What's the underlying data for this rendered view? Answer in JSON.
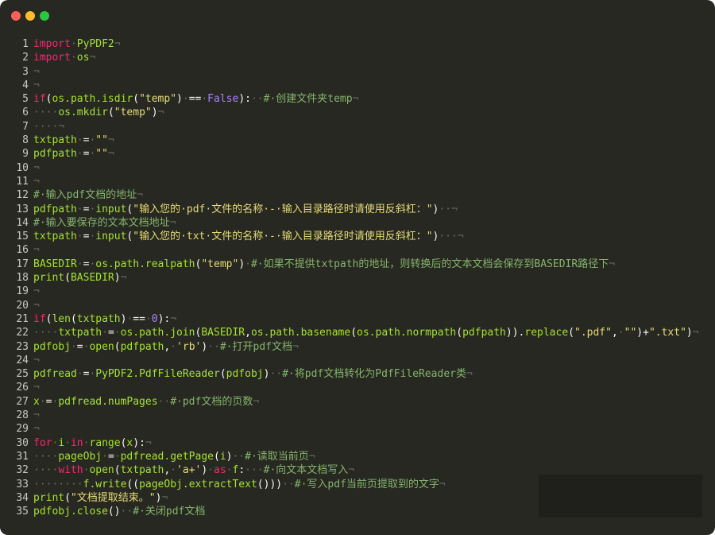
{
  "window": {
    "traffic_lights": [
      "close",
      "minimize",
      "maximize"
    ],
    "colors": {
      "background": "#272822",
      "close": "#ff5f57",
      "minimize": "#febc2e",
      "maximize": "#28c840"
    }
  },
  "code": {
    "lines": [
      {
        "n": "1",
        "tokens": [
          {
            "t": "kw",
            "v": "import"
          },
          {
            "t": "ws",
            "v": "·"
          },
          {
            "t": "id",
            "v": "PyPDF2"
          },
          {
            "t": "nl",
            "v": "¬"
          }
        ]
      },
      {
        "n": "2",
        "tokens": [
          {
            "t": "kw",
            "v": "import"
          },
          {
            "t": "ws",
            "v": "·"
          },
          {
            "t": "id",
            "v": "os"
          },
          {
            "t": "nl",
            "v": "¬"
          }
        ]
      },
      {
        "n": "3",
        "tokens": [
          {
            "t": "nl",
            "v": "¬"
          }
        ]
      },
      {
        "n": "4",
        "tokens": [
          {
            "t": "nl",
            "v": "¬"
          }
        ]
      },
      {
        "n": "5",
        "tokens": [
          {
            "t": "kw",
            "v": "if"
          },
          {
            "t": "op",
            "v": "("
          },
          {
            "t": "id",
            "v": "os.path.isdir"
          },
          {
            "t": "op",
            "v": "("
          },
          {
            "t": "str",
            "v": "\"temp\""
          },
          {
            "t": "op",
            "v": ")"
          },
          {
            "t": "ws",
            "v": "·"
          },
          {
            "t": "op",
            "v": "=="
          },
          {
            "t": "ws",
            "v": "·"
          },
          {
            "t": "const",
            "v": "False"
          },
          {
            "t": "op",
            "v": "):"
          },
          {
            "t": "ws",
            "v": "··"
          },
          {
            "t": "com",
            "v": "#·创建文件夹temp"
          },
          {
            "t": "nl",
            "v": "¬"
          }
        ]
      },
      {
        "n": "6",
        "tokens": [
          {
            "t": "ws",
            "v": "····"
          },
          {
            "t": "id",
            "v": "os.mkdir"
          },
          {
            "t": "op",
            "v": "("
          },
          {
            "t": "str",
            "v": "\"temp\""
          },
          {
            "t": "op",
            "v": ")"
          },
          {
            "t": "nl",
            "v": "¬"
          }
        ]
      },
      {
        "n": "7",
        "tokens": [
          {
            "t": "ws",
            "v": "····"
          },
          {
            "t": "nl",
            "v": "¬"
          }
        ]
      },
      {
        "n": "8",
        "tokens": [
          {
            "t": "id",
            "v": "txtpath"
          },
          {
            "t": "ws",
            "v": "·"
          },
          {
            "t": "op",
            "v": "="
          },
          {
            "t": "ws",
            "v": "·"
          },
          {
            "t": "str",
            "v": "\"\""
          },
          {
            "t": "nl",
            "v": "¬"
          }
        ]
      },
      {
        "n": "9",
        "tokens": [
          {
            "t": "id",
            "v": "pdfpath"
          },
          {
            "t": "ws",
            "v": "·"
          },
          {
            "t": "op",
            "v": "="
          },
          {
            "t": "ws",
            "v": "·"
          },
          {
            "t": "str",
            "v": "\"\""
          },
          {
            "t": "nl",
            "v": "¬"
          }
        ]
      },
      {
        "n": "10",
        "tokens": [
          {
            "t": "nl",
            "v": "¬"
          }
        ]
      },
      {
        "n": "11",
        "tokens": [
          {
            "t": "nl",
            "v": "¬"
          }
        ]
      },
      {
        "n": "12",
        "tokens": [
          {
            "t": "com",
            "v": "#·输入pdf文档的地址"
          },
          {
            "t": "nl",
            "v": "¬"
          }
        ]
      },
      {
        "n": "13",
        "tokens": [
          {
            "t": "id",
            "v": "pdfpath"
          },
          {
            "t": "ws",
            "v": "·"
          },
          {
            "t": "op",
            "v": "="
          },
          {
            "t": "ws",
            "v": "·"
          },
          {
            "t": "fn",
            "v": "input"
          },
          {
            "t": "op",
            "v": "("
          },
          {
            "t": "str",
            "v": "\"输入您的·pdf·文件的名称·-·输入目录路径时请使用反斜杠：\""
          },
          {
            "t": "op",
            "v": ")"
          },
          {
            "t": "ws",
            "v": "··"
          },
          {
            "t": "nl",
            "v": "¬"
          }
        ]
      },
      {
        "n": "14",
        "tokens": [
          {
            "t": "com",
            "v": "#·输入要保存的文本文档地址"
          },
          {
            "t": "nl",
            "v": "¬"
          }
        ]
      },
      {
        "n": "15",
        "tokens": [
          {
            "t": "id",
            "v": "txtpath"
          },
          {
            "t": "ws",
            "v": "·"
          },
          {
            "t": "op",
            "v": "="
          },
          {
            "t": "ws",
            "v": "·"
          },
          {
            "t": "fn",
            "v": "input"
          },
          {
            "t": "op",
            "v": "("
          },
          {
            "t": "str",
            "v": "\"输入您的·txt·文件的名称·-·输入目录路径时请使用反斜杠：\""
          },
          {
            "t": "op",
            "v": ")"
          },
          {
            "t": "ws",
            "v": "···"
          },
          {
            "t": "nl",
            "v": "¬"
          }
        ]
      },
      {
        "n": "16",
        "tokens": [
          {
            "t": "nl",
            "v": "¬"
          }
        ]
      },
      {
        "n": "17",
        "tokens": [
          {
            "t": "id",
            "v": "BASEDIR"
          },
          {
            "t": "ws",
            "v": "·"
          },
          {
            "t": "op",
            "v": "="
          },
          {
            "t": "ws",
            "v": "·"
          },
          {
            "t": "id",
            "v": "os.path.realpath"
          },
          {
            "t": "op",
            "v": "("
          },
          {
            "t": "str",
            "v": "\"temp\""
          },
          {
            "t": "op",
            "v": ")"
          },
          {
            "t": "ws",
            "v": "·"
          },
          {
            "t": "com",
            "v": "#·如果不提供txtpath的地址，则转换后的文本文档会保存到BASEDIR路径下"
          },
          {
            "t": "nl",
            "v": "¬"
          }
        ]
      },
      {
        "n": "18",
        "tokens": [
          {
            "t": "fn",
            "v": "print"
          },
          {
            "t": "op",
            "v": "("
          },
          {
            "t": "id",
            "v": "BASEDIR"
          },
          {
            "t": "op",
            "v": ")"
          },
          {
            "t": "nl",
            "v": "¬"
          }
        ]
      },
      {
        "n": "19",
        "tokens": [
          {
            "t": "nl",
            "v": "¬"
          }
        ]
      },
      {
        "n": "20",
        "tokens": [
          {
            "t": "nl",
            "v": "¬"
          }
        ]
      },
      {
        "n": "21",
        "tokens": [
          {
            "t": "kw",
            "v": "if"
          },
          {
            "t": "op",
            "v": "("
          },
          {
            "t": "fn",
            "v": "len"
          },
          {
            "t": "op",
            "v": "("
          },
          {
            "t": "id",
            "v": "txtpath"
          },
          {
            "t": "op",
            "v": ")"
          },
          {
            "t": "ws",
            "v": "·"
          },
          {
            "t": "op",
            "v": "=="
          },
          {
            "t": "ws",
            "v": "·"
          },
          {
            "t": "num",
            "v": "0"
          },
          {
            "t": "op",
            "v": "):"
          },
          {
            "t": "nl",
            "v": "¬"
          }
        ]
      },
      {
        "n": "22",
        "tokens": [
          {
            "t": "ws",
            "v": "····"
          },
          {
            "t": "id",
            "v": "txtpath"
          },
          {
            "t": "ws",
            "v": "·"
          },
          {
            "t": "op",
            "v": "="
          },
          {
            "t": "ws",
            "v": "·"
          },
          {
            "t": "id",
            "v": "os.path.join"
          },
          {
            "t": "op",
            "v": "("
          },
          {
            "t": "id",
            "v": "BASEDIR"
          },
          {
            "t": "op",
            "v": ","
          },
          {
            "t": "id",
            "v": "os.path.basename"
          },
          {
            "t": "op",
            "v": "("
          },
          {
            "t": "id",
            "v": "os.path.normpath"
          },
          {
            "t": "op",
            "v": "("
          },
          {
            "t": "id",
            "v": "pdfpath"
          },
          {
            "t": "op",
            "v": "))."
          },
          {
            "t": "id",
            "v": "replace"
          },
          {
            "t": "op",
            "v": "("
          },
          {
            "t": "str",
            "v": "\".pdf\""
          },
          {
            "t": "op",
            "v": ","
          },
          {
            "t": "ws",
            "v": "·"
          },
          {
            "t": "str",
            "v": "\"\""
          },
          {
            "t": "op",
            "v": ")+"
          },
          {
            "t": "str",
            "v": "\".txt\""
          },
          {
            "t": "op",
            "v": ")"
          },
          {
            "t": "nl",
            "v": "¬"
          }
        ]
      },
      {
        "n": "23",
        "tokens": [
          {
            "t": "id",
            "v": "pdfobj"
          },
          {
            "t": "ws",
            "v": "·"
          },
          {
            "t": "op",
            "v": "="
          },
          {
            "t": "ws",
            "v": "·"
          },
          {
            "t": "fn",
            "v": "open"
          },
          {
            "t": "op",
            "v": "("
          },
          {
            "t": "id",
            "v": "pdfpath"
          },
          {
            "t": "op",
            "v": ","
          },
          {
            "t": "ws",
            "v": "·"
          },
          {
            "t": "str",
            "v": "'rb'"
          },
          {
            "t": "op",
            "v": ")"
          },
          {
            "t": "ws",
            "v": "··"
          },
          {
            "t": "com",
            "v": "#·打开pdf文档"
          },
          {
            "t": "nl",
            "v": "¬"
          }
        ]
      },
      {
        "n": "24",
        "tokens": [
          {
            "t": "nl",
            "v": "¬"
          }
        ]
      },
      {
        "n": "25",
        "tokens": [
          {
            "t": "id",
            "v": "pdfread"
          },
          {
            "t": "ws",
            "v": "·"
          },
          {
            "t": "op",
            "v": "="
          },
          {
            "t": "ws",
            "v": "·"
          },
          {
            "t": "id",
            "v": "PyPDF2.PdfFileReader"
          },
          {
            "t": "op",
            "v": "("
          },
          {
            "t": "id",
            "v": "pdfobj"
          },
          {
            "t": "op",
            "v": ")"
          },
          {
            "t": "ws",
            "v": "··"
          },
          {
            "t": "com",
            "v": "#·将pdf文档转化为PdfFileReader类"
          },
          {
            "t": "nl",
            "v": "¬"
          }
        ]
      },
      {
        "n": "26",
        "tokens": [
          {
            "t": "nl",
            "v": "¬"
          }
        ]
      },
      {
        "n": "27",
        "tokens": [
          {
            "t": "id",
            "v": "x"
          },
          {
            "t": "ws",
            "v": "·"
          },
          {
            "t": "op",
            "v": "="
          },
          {
            "t": "ws",
            "v": "·"
          },
          {
            "t": "id",
            "v": "pdfread.numPages"
          },
          {
            "t": "ws",
            "v": "··"
          },
          {
            "t": "com",
            "v": "#·pdf文档的页数"
          },
          {
            "t": "nl",
            "v": "¬"
          }
        ]
      },
      {
        "n": "28",
        "tokens": [
          {
            "t": "nl",
            "v": "¬"
          }
        ]
      },
      {
        "n": "29",
        "tokens": [
          {
            "t": "nl",
            "v": "¬"
          }
        ]
      },
      {
        "n": "30",
        "tokens": [
          {
            "t": "kw",
            "v": "for"
          },
          {
            "t": "ws",
            "v": "·"
          },
          {
            "t": "id",
            "v": "i"
          },
          {
            "t": "ws",
            "v": "·"
          },
          {
            "t": "kw",
            "v": "in"
          },
          {
            "t": "ws",
            "v": "·"
          },
          {
            "t": "fn",
            "v": "range"
          },
          {
            "t": "op",
            "v": "("
          },
          {
            "t": "id",
            "v": "x"
          },
          {
            "t": "op",
            "v": "):"
          },
          {
            "t": "nl",
            "v": "¬"
          }
        ]
      },
      {
        "n": "31",
        "tokens": [
          {
            "t": "ws",
            "v": "····"
          },
          {
            "t": "id",
            "v": "pageObj"
          },
          {
            "t": "ws",
            "v": "·"
          },
          {
            "t": "op",
            "v": "="
          },
          {
            "t": "ws",
            "v": "·"
          },
          {
            "t": "id",
            "v": "pdfread.getPage"
          },
          {
            "t": "op",
            "v": "("
          },
          {
            "t": "id",
            "v": "i"
          },
          {
            "t": "op",
            "v": ")"
          },
          {
            "t": "ws",
            "v": "··"
          },
          {
            "t": "com",
            "v": "#·读取当前页"
          },
          {
            "t": "nl",
            "v": "¬"
          }
        ]
      },
      {
        "n": "32",
        "tokens": [
          {
            "t": "ws",
            "v": "····"
          },
          {
            "t": "kw",
            "v": "with"
          },
          {
            "t": "ws",
            "v": "·"
          },
          {
            "t": "fn",
            "v": "open"
          },
          {
            "t": "op",
            "v": "("
          },
          {
            "t": "id",
            "v": "txtpath"
          },
          {
            "t": "op",
            "v": ","
          },
          {
            "t": "ws",
            "v": "·"
          },
          {
            "t": "str",
            "v": "'a+'"
          },
          {
            "t": "op",
            "v": ")"
          },
          {
            "t": "ws",
            "v": "·"
          },
          {
            "t": "kw",
            "v": "as"
          },
          {
            "t": "ws",
            "v": "·"
          },
          {
            "t": "id",
            "v": "f"
          },
          {
            "t": "op",
            "v": ":"
          },
          {
            "t": "ws",
            "v": "···"
          },
          {
            "t": "com",
            "v": "#·向文本文档写入"
          },
          {
            "t": "nl",
            "v": "¬"
          }
        ]
      },
      {
        "n": "33",
        "tokens": [
          {
            "t": "ws",
            "v": "········"
          },
          {
            "t": "id",
            "v": "f.write"
          },
          {
            "t": "op",
            "v": "(("
          },
          {
            "t": "id",
            "v": "pageObj.extractText"
          },
          {
            "t": "op",
            "v": "()))"
          },
          {
            "t": "ws",
            "v": "··"
          },
          {
            "t": "com",
            "v": "#·写入pdf当前页提取到的文字"
          },
          {
            "t": "nl",
            "v": "¬"
          }
        ]
      },
      {
        "n": "34",
        "tokens": [
          {
            "t": "fn",
            "v": "print"
          },
          {
            "t": "op",
            "v": "("
          },
          {
            "t": "str",
            "v": "\"文档提取结束。\""
          },
          {
            "t": "op",
            "v": ")"
          },
          {
            "t": "nl",
            "v": "¬"
          }
        ]
      },
      {
        "n": "35",
        "tokens": [
          {
            "t": "id",
            "v": "pdfobj.close"
          },
          {
            "t": "op",
            "v": "()"
          },
          {
            "t": "ws",
            "v": "··"
          },
          {
            "t": "com",
            "v": "#·关闭pdf文档"
          }
        ]
      }
    ]
  }
}
